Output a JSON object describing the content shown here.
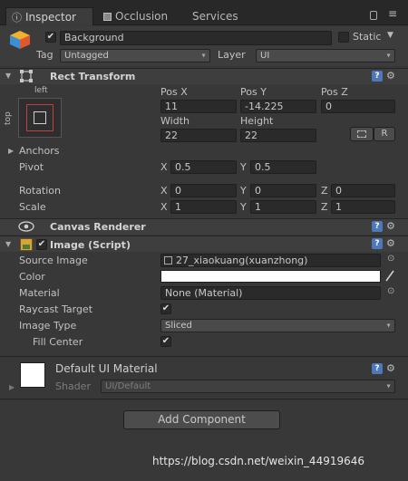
{
  "tabs": {
    "inspector": "Inspector",
    "occlusion": "Occlusion",
    "services": "Services"
  },
  "gameobject": {
    "active": true,
    "name": "Background",
    "static_label": "Static",
    "static_checked": false,
    "tag_label": "Tag",
    "tag_value": "Untagged",
    "layer_label": "Layer",
    "layer_value": "UI"
  },
  "rect_transform": {
    "title": "Rect Transform",
    "anchor_h": "left",
    "anchor_v": "top",
    "pos_x_label": "Pos X",
    "pos_y_label": "Pos Y",
    "pos_z_label": "Pos Z",
    "pos_x": "11",
    "pos_y": "-14.225",
    "pos_z": "0",
    "width_label": "Width",
    "height_label": "Height",
    "width": "22",
    "height": "22",
    "raw_edit_label": "R",
    "anchors_label": "Anchors",
    "pivot_label": "Pivot",
    "pivot_x": "0.5",
    "pivot_y": "0.5",
    "rotation_label": "Rotation",
    "rot_x": "0",
    "rot_y": "0",
    "rot_z": "0",
    "scale_label": "Scale",
    "scale_x": "1",
    "scale_y": "1",
    "scale_z": "1",
    "axis_x": "X",
    "axis_y": "Y",
    "axis_z": "Z"
  },
  "canvas_renderer": {
    "title": "Canvas Renderer"
  },
  "image": {
    "title": "Image (Script)",
    "enabled": true,
    "source_image_label": "Source Image",
    "source_image": "27_xiaokuang(xuanzhong)",
    "color_label": "Color",
    "color": "#ffffff",
    "material_label": "Material",
    "material": "None (Material)",
    "raycast_label": "Raycast Target",
    "raycast": true,
    "image_type_label": "Image Type",
    "image_type": "Sliced",
    "fill_center_label": "Fill Center",
    "fill_center": true
  },
  "material_preview": {
    "title": "Default UI Material",
    "shader_label": "Shader",
    "shader_value": "UI/Default"
  },
  "add_component_label": "Add Component",
  "watermark": "https://blog.csdn.net/weixin_44919646",
  "colors": {
    "panel": "#383838",
    "field": "#2a2a2a",
    "accent": "#4f78b8"
  }
}
